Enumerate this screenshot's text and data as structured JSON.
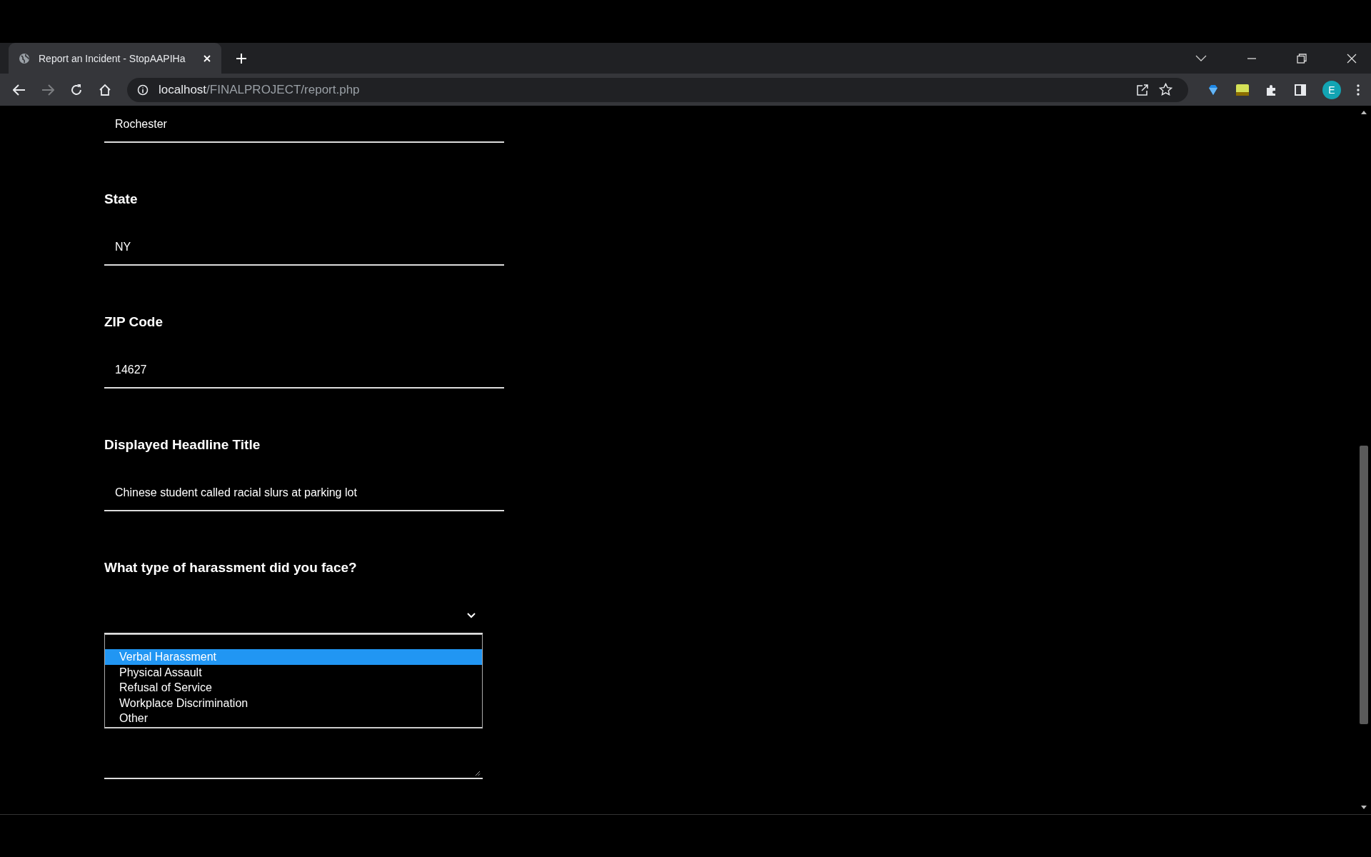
{
  "browser": {
    "tab": {
      "title": "Report an Incident - StopAAPIHa"
    },
    "url": {
      "host": "localhost",
      "path": "/FINALPROJECT/report.php"
    },
    "profile_initial": "E"
  },
  "form": {
    "fields": [
      {
        "kind": "text",
        "value": "Rochester"
      },
      {
        "kind": "text",
        "label": "State",
        "value": "NY"
      },
      {
        "kind": "text",
        "label": "ZIP Code",
        "value": "14627"
      },
      {
        "kind": "text",
        "label": "Displayed Headline Title",
        "value": "Chinese student called racial slurs at parking lot"
      },
      {
        "kind": "select",
        "label": "What type of harassment did you face?",
        "expanded": true,
        "options": [
          {
            "label": "Verbal Harassment",
            "selected": true
          },
          {
            "label": "Physical Assault",
            "selected": false
          },
          {
            "label": "Refusal of Service",
            "selected": false
          },
          {
            "label": "Workplace Discrimination",
            "selected": false
          },
          {
            "label": "Other",
            "selected": false
          }
        ]
      },
      {
        "kind": "textarea"
      }
    ]
  }
}
